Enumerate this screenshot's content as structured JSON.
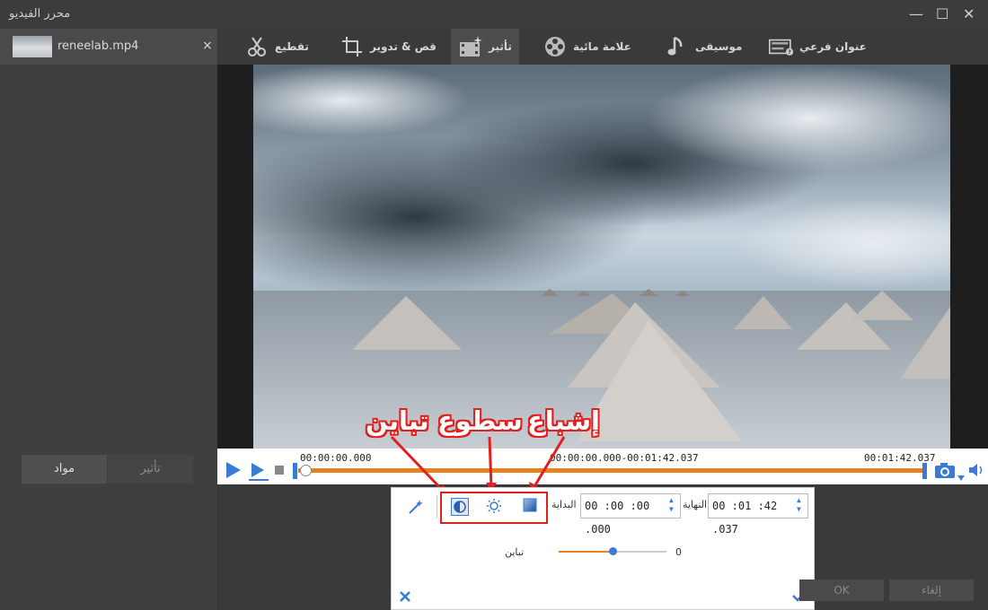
{
  "window": {
    "title": "محرر الفيديو",
    "minimize": "—",
    "maximize": "☐",
    "close": "✕"
  },
  "sidebar": {
    "file_name": "reneelab.mp4",
    "close": "×",
    "effect_button": "تأثير",
    "material_button": "مواد"
  },
  "toolbar": {
    "items": [
      {
        "label": "تقطيع",
        "icon": "crop-cut-icon"
      },
      {
        "label": "قص & تدوير",
        "icon": "crop-rotate-icon"
      },
      {
        "label": "تأثير",
        "icon": "effect-film-icon",
        "active": true
      },
      {
        "label": "علامة مائية",
        "icon": "film-reel-icon"
      },
      {
        "label": "موسيقى",
        "icon": "music-note-icon"
      },
      {
        "label": "عنوان فرعي",
        "icon": "subtitle-icon"
      }
    ]
  },
  "playback": {
    "start_time": "00:00:00.000",
    "range": "00:00:00.000-00:01:42.037",
    "end_time": "00:01:42.037"
  },
  "effects_panel": {
    "start_label": "البداية",
    "start_value": "00 :00 :00 .000",
    "end_label": "النهاية",
    "end_value": "00 :01 :42 .037",
    "slider_label": "تباين",
    "slider_value": "0",
    "slider_level": 0.5
  },
  "annotations": {
    "contrast": "تباين",
    "brightness": "سطوع",
    "saturation": "إشباع"
  },
  "footer": {
    "ok": "OK",
    "cancel": "إلغاء"
  },
  "colors": {
    "accent": "#e8821e",
    "blue": "#3a7bd5",
    "annotation_red": "#e0201f"
  }
}
